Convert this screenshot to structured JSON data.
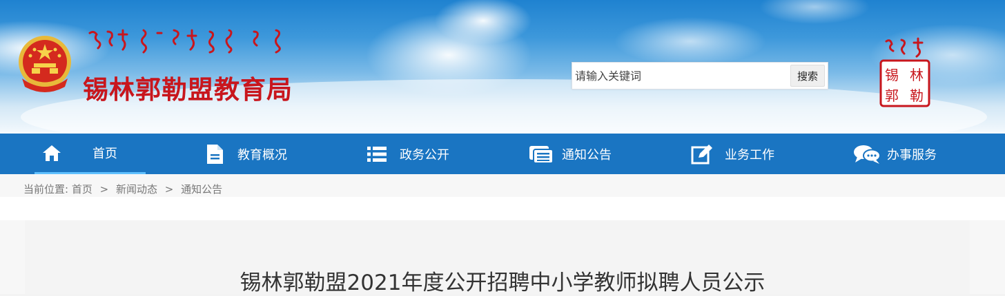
{
  "header": {
    "site_title": "锡林郭勒盟教育局",
    "search": {
      "placeholder": "请输入关键词",
      "button_label": "搜索"
    },
    "seal_text": [
      "锡",
      "林",
      "郭",
      "勒"
    ]
  },
  "nav": {
    "items": [
      {
        "label": "首页",
        "icon": "home-icon"
      },
      {
        "label": "教育概况",
        "icon": "document-icon"
      },
      {
        "label": "政务公开",
        "icon": "list-icon"
      },
      {
        "label": "通知公告",
        "icon": "notice-icon"
      },
      {
        "label": "业务工作",
        "icon": "edit-icon"
      },
      {
        "label": "办事服务",
        "icon": "chat-icon"
      }
    ]
  },
  "breadcrumb": {
    "prefix": "当前位置:",
    "items": [
      "首页",
      "新闻动态",
      "通知公告"
    ],
    "separator": ">"
  },
  "article": {
    "title": "锡林郭勒盟2021年度公开招聘中小学教师拟聘人员公示"
  },
  "colors": {
    "nav_bg": "#1a75c2",
    "title_red": "#c8161d",
    "active_underline": "#5fc0ff"
  }
}
